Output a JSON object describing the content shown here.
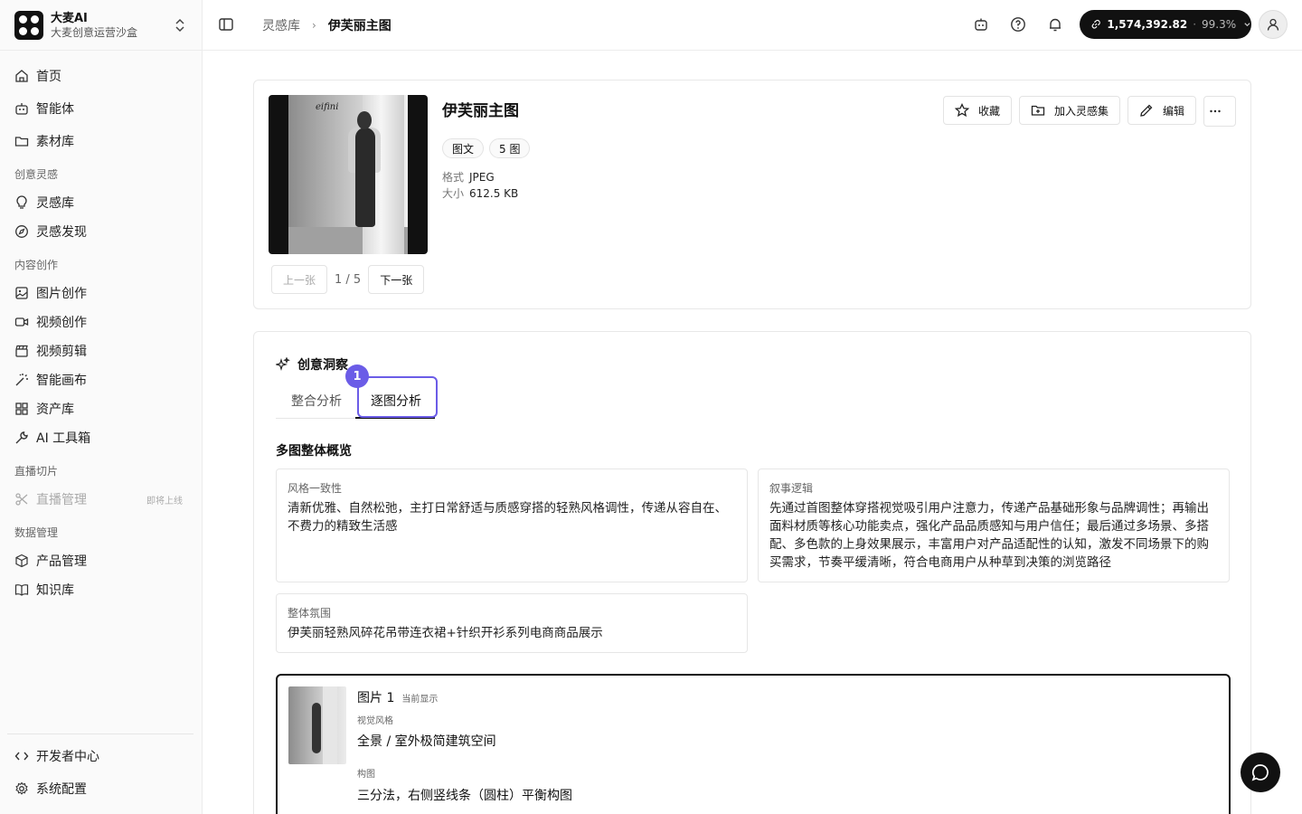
{
  "brand": {
    "name": "大麦AI",
    "subtitle": "大麦创意运营沙盒"
  },
  "sidebar": {
    "items_top": [
      {
        "label": "首页",
        "icon": "home-icon"
      },
      {
        "label": "智能体",
        "icon": "bot-icon"
      },
      {
        "label": "素材库",
        "icon": "folder-icon"
      }
    ],
    "section_inspiration": "创意灵感",
    "items_inspiration": [
      {
        "label": "灵感库",
        "icon": "lightbulb-icon"
      },
      {
        "label": "灵感发现",
        "icon": "compass-icon"
      }
    ],
    "section_content": "内容创作",
    "items_content": [
      {
        "label": "图片创作",
        "icon": "image-icon"
      },
      {
        "label": "视频创作",
        "icon": "video-icon"
      },
      {
        "label": "视频剪辑",
        "icon": "clapper-icon"
      },
      {
        "label": "智能画布",
        "icon": "wand-icon"
      },
      {
        "label": "资产库",
        "icon": "grid-icon"
      },
      {
        "label": "AI 工具箱",
        "icon": "wrench-icon"
      }
    ],
    "section_live": "直播切片",
    "items_live": [
      {
        "label": "直播管理",
        "icon": "scissors-icon",
        "badge": "即将上线"
      }
    ],
    "section_data": "数据管理",
    "items_data": [
      {
        "label": "产品管理",
        "icon": "box-icon"
      },
      {
        "label": "知识库",
        "icon": "book-icon"
      }
    ],
    "items_bottom": [
      {
        "label": "开发者中心",
        "icon": "code-icon"
      },
      {
        "label": "系统配置",
        "icon": "gear-icon"
      }
    ]
  },
  "header": {
    "breadcrumb": [
      "灵感库",
      "伊芙丽主图"
    ],
    "credits": {
      "amount": "1,574,392.82",
      "percent": "99.3%"
    }
  },
  "detail": {
    "title": "伊芙丽主图",
    "tags": [
      "图文",
      "5 图"
    ],
    "meta": [
      {
        "key": "格式",
        "value": "JPEG"
      },
      {
        "key": "大小",
        "value": "612.5 KB"
      }
    ],
    "thumb_logo": "eifini",
    "pager": {
      "prev": "上一张",
      "count": "1 / 5",
      "next": "下一张"
    },
    "actions": {
      "favorite": "收藏",
      "add_to_set": "加入灵感集",
      "edit": "编辑"
    }
  },
  "insight": {
    "title": "创意洞察",
    "tabs": [
      "整合分析",
      "逐图分析"
    ],
    "active_tab": 1,
    "annotation_number": "1",
    "overview_title": "多图整体概览",
    "boxes": [
      {
        "label": "风格一致性",
        "text": "清新优雅、自然松弛，主打日常舒适与质感穿搭的轻熟风格调性，传递从容自在、不费力的精致生活感"
      },
      {
        "label": "叙事逻辑",
        "text": "先通过首图整体穿搭视觉吸引用户注意力，传递产品基础形象与品牌调性；再输出面料材质等核心功能卖点，强化产品品质感知与用户信任；最后通过多场景、多搭配、多色款的上身效果展示，丰富用户对产品适配性的认知，激发不同场景下的购买需求，节奏平缓清晰，符合电商用户从种草到决策的浏览路径"
      },
      {
        "label": "整体氛围",
        "text": "伊芙丽轻熟风碎花吊带连衣裙+针织开衫系列电商商品展示"
      }
    ],
    "image_card": {
      "name": "图片 1",
      "current": "当前显示",
      "fields": [
        {
          "label": "视觉风格",
          "value": "全景 / 室外极简建筑空间"
        },
        {
          "label": "构图",
          "value": "三分法，右侧竖线条（圆柱）平衡构图"
        }
      ]
    }
  },
  "colors": {
    "accent": "#6b5ce7",
    "dark": "#111111"
  }
}
